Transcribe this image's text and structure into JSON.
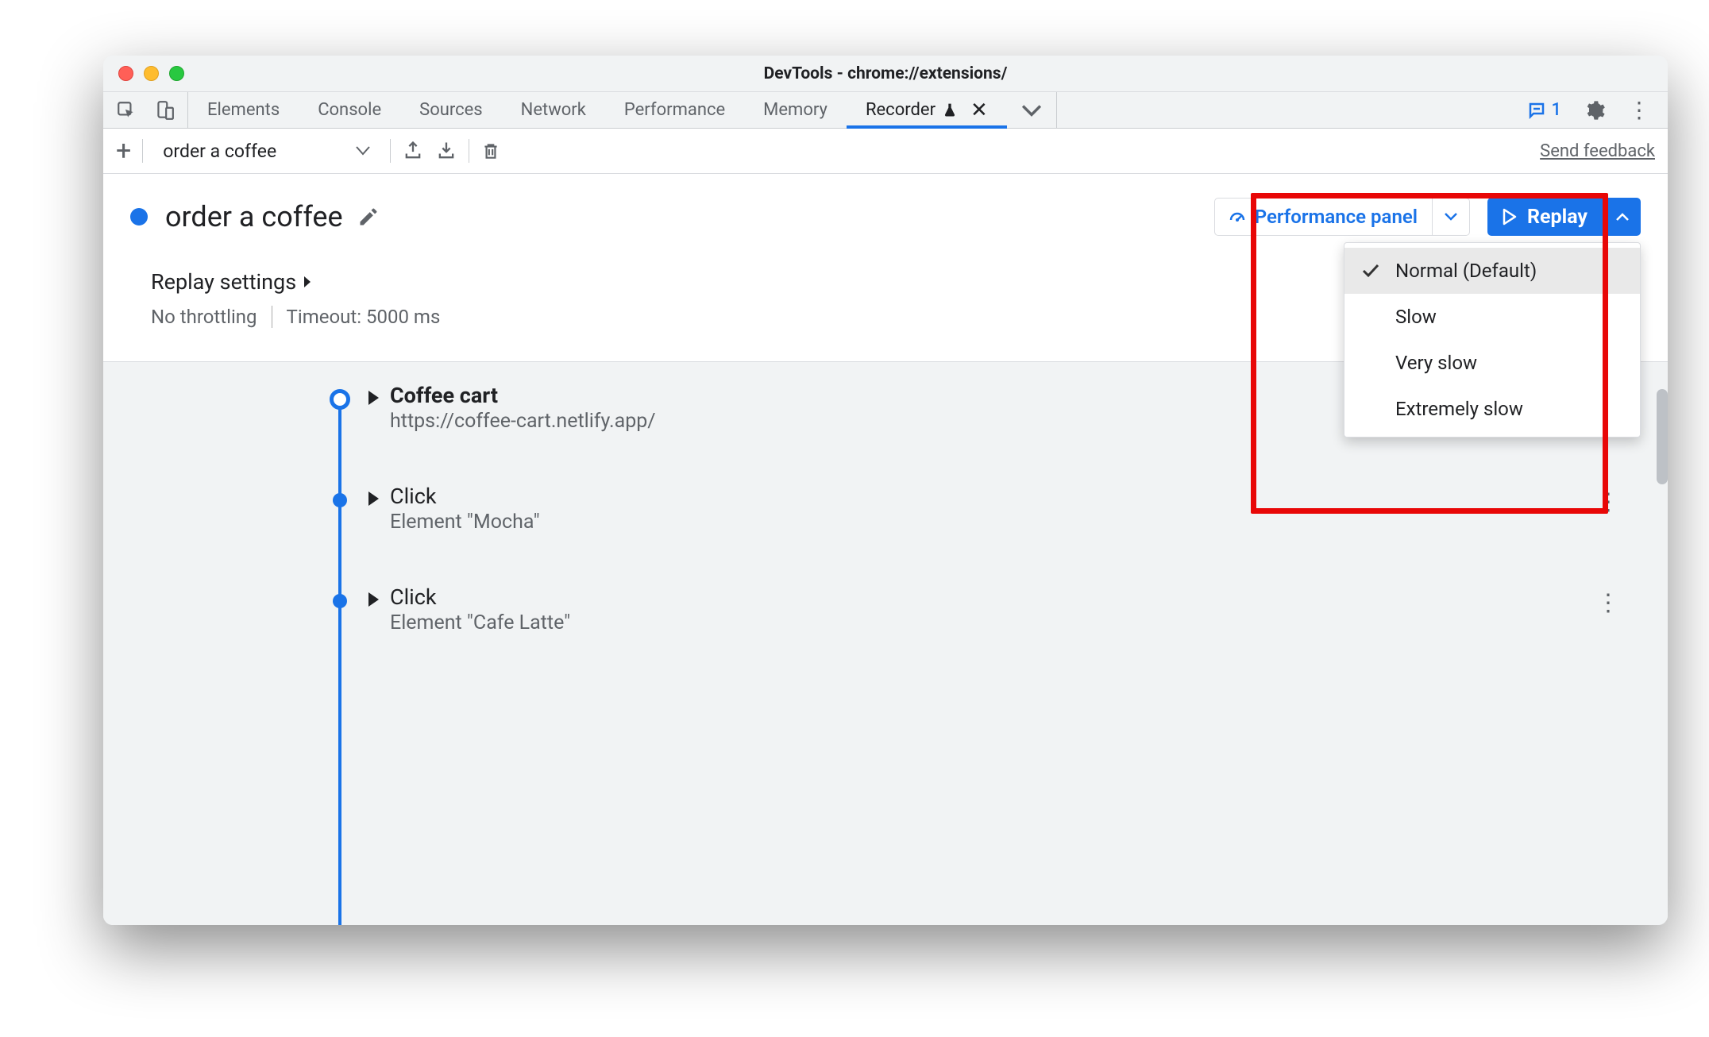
{
  "window": {
    "title": "DevTools - chrome://extensions/"
  },
  "tabs": {
    "items": [
      "Elements",
      "Console",
      "Sources",
      "Network",
      "Performance",
      "Memory",
      "Recorder"
    ],
    "active": "Recorder"
  },
  "issues_count": "1",
  "toolbar": {
    "recording_select": "order a coffee",
    "send_feedback": "Send feedback"
  },
  "recording": {
    "title": "order a coffee"
  },
  "actions": {
    "performance_panel": "Performance panel",
    "replay": "Replay"
  },
  "speed_menu": {
    "items": [
      "Normal (Default)",
      "Slow",
      "Very slow",
      "Extremely slow"
    ],
    "selected_index": 0
  },
  "settings": {
    "title": "Replay settings",
    "throttling": "No throttling",
    "timeout": "Timeout: 5000 ms"
  },
  "steps": [
    {
      "title": "Coffee cart",
      "sub": "https://coffee-cart.netlify.app/",
      "bold": true,
      "first": true
    },
    {
      "title": "Click",
      "sub": "Element \"Mocha\"",
      "bold": false,
      "first": false
    },
    {
      "title": "Click",
      "sub": "Element \"Cafe Latte\"",
      "bold": false,
      "first": false
    }
  ]
}
